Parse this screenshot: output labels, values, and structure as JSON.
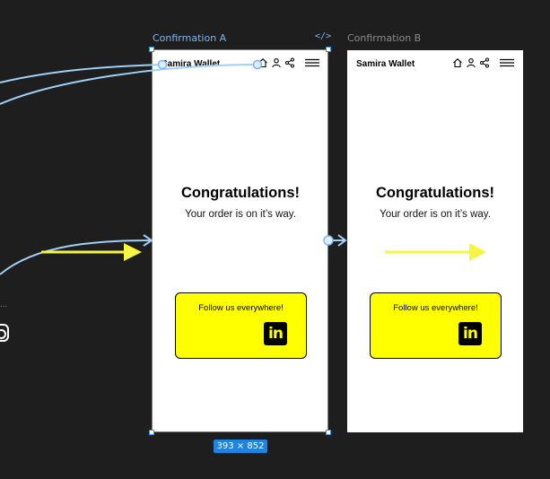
{
  "frames": [
    {
      "label": "Confirmation A",
      "brand": "Samira Wallet",
      "title": "Congratulations!",
      "subtitle": "Your order is on it’s way.",
      "card_text": "Follow us everywhere!",
      "linkedin_text": "in"
    },
    {
      "label": "Confirmation B",
      "brand": "Samira Wallet",
      "title": "Congratulations!",
      "subtitle": "Your order is on it’s way.",
      "card_text": "Follow us everywhere!",
      "linkedin_text": "in"
    }
  ],
  "selection": {
    "code_icon": "</>",
    "dimensions": "393 × 852"
  },
  "offscreen": {
    "label": "..."
  },
  "colors": {
    "canvas_bg": "#1e1e1e",
    "selection_blue": "#2f8de4",
    "accent_yellow": "#ffff00",
    "connector_light_blue": "#9fd0f5"
  }
}
